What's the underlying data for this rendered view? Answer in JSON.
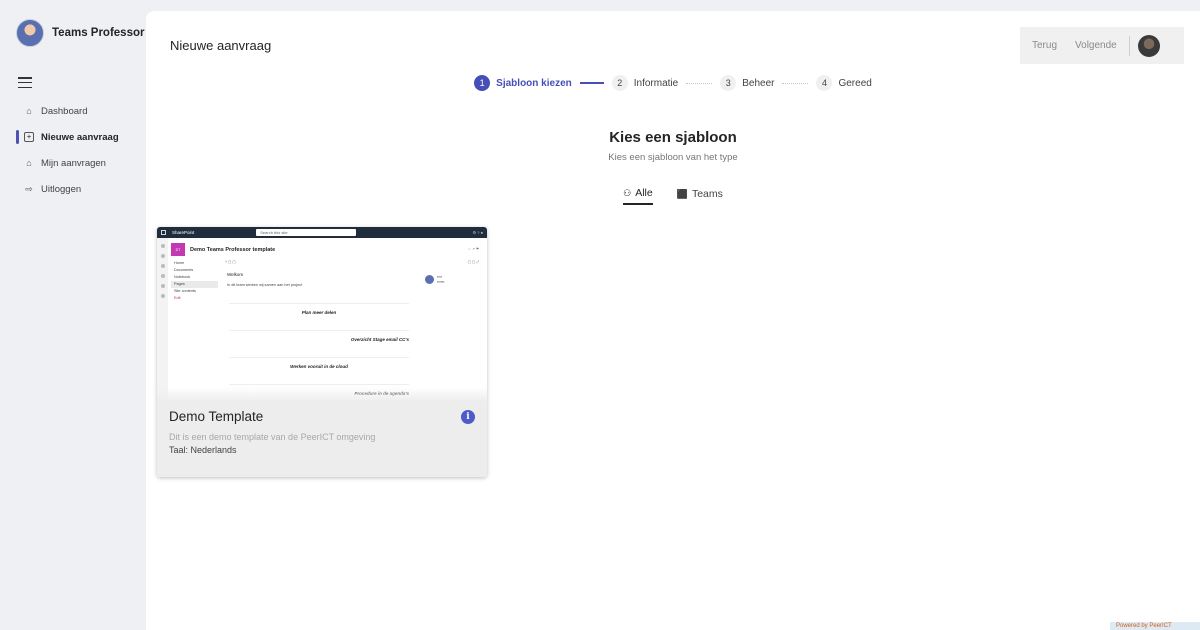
{
  "brand": {
    "name": "Teams Professor"
  },
  "sidebar": {
    "items": [
      {
        "label": "Dashboard",
        "icon": "home-icon"
      },
      {
        "label": "Nieuwe aanvraag",
        "icon": "new-request-icon",
        "active": true
      },
      {
        "label": "Mijn aanvragen",
        "icon": "inbox-icon"
      },
      {
        "label": "Uitloggen",
        "icon": "sign-out-icon"
      }
    ]
  },
  "header": {
    "title": "Nieuwe aanvraag",
    "back_label": "Terug",
    "next_label": "Volgende"
  },
  "stepper": {
    "steps": [
      {
        "num": "1",
        "label": "Sjabloon kiezen",
        "active": true
      },
      {
        "num": "2",
        "label": "Informatie"
      },
      {
        "num": "3",
        "label": "Beheer"
      },
      {
        "num": "4",
        "label": "Gereed"
      }
    ]
  },
  "main": {
    "heading": "Kies een sjabloon",
    "subheading": "Kies een sjabloon van het type",
    "tabs": [
      {
        "label": "Alle",
        "icon": "people-icon",
        "active": true
      },
      {
        "label": "Teams",
        "icon": "teams-icon"
      }
    ]
  },
  "card": {
    "title": "Demo Template",
    "description": "Dit is een demo template van de PeerICT omgeving",
    "language": "Taal: Nederlands",
    "preview": {
      "app_name": "SharePoint",
      "search_placeholder": "Search this site",
      "site_title": "Demo Teams Professor template",
      "nav": [
        "Home",
        "Documents",
        "Notebook",
        "Pages",
        "Site contents",
        "Edit"
      ],
      "welcome": "Welkom",
      "welcome_text": "In dit team werken wij samen aan het project",
      "rows": [
        "Plan meer delen",
        "Overzicht Stage email CC's",
        "Werken vooruit in de cloud",
        "Procedure in de agenda's"
      ]
    }
  },
  "footer": {
    "powered": "Powered by PeerICT"
  },
  "colors": {
    "accent": "#464eb8",
    "sidebar_bg": "#eef0f4",
    "card_footer_bg": "#ededed"
  }
}
